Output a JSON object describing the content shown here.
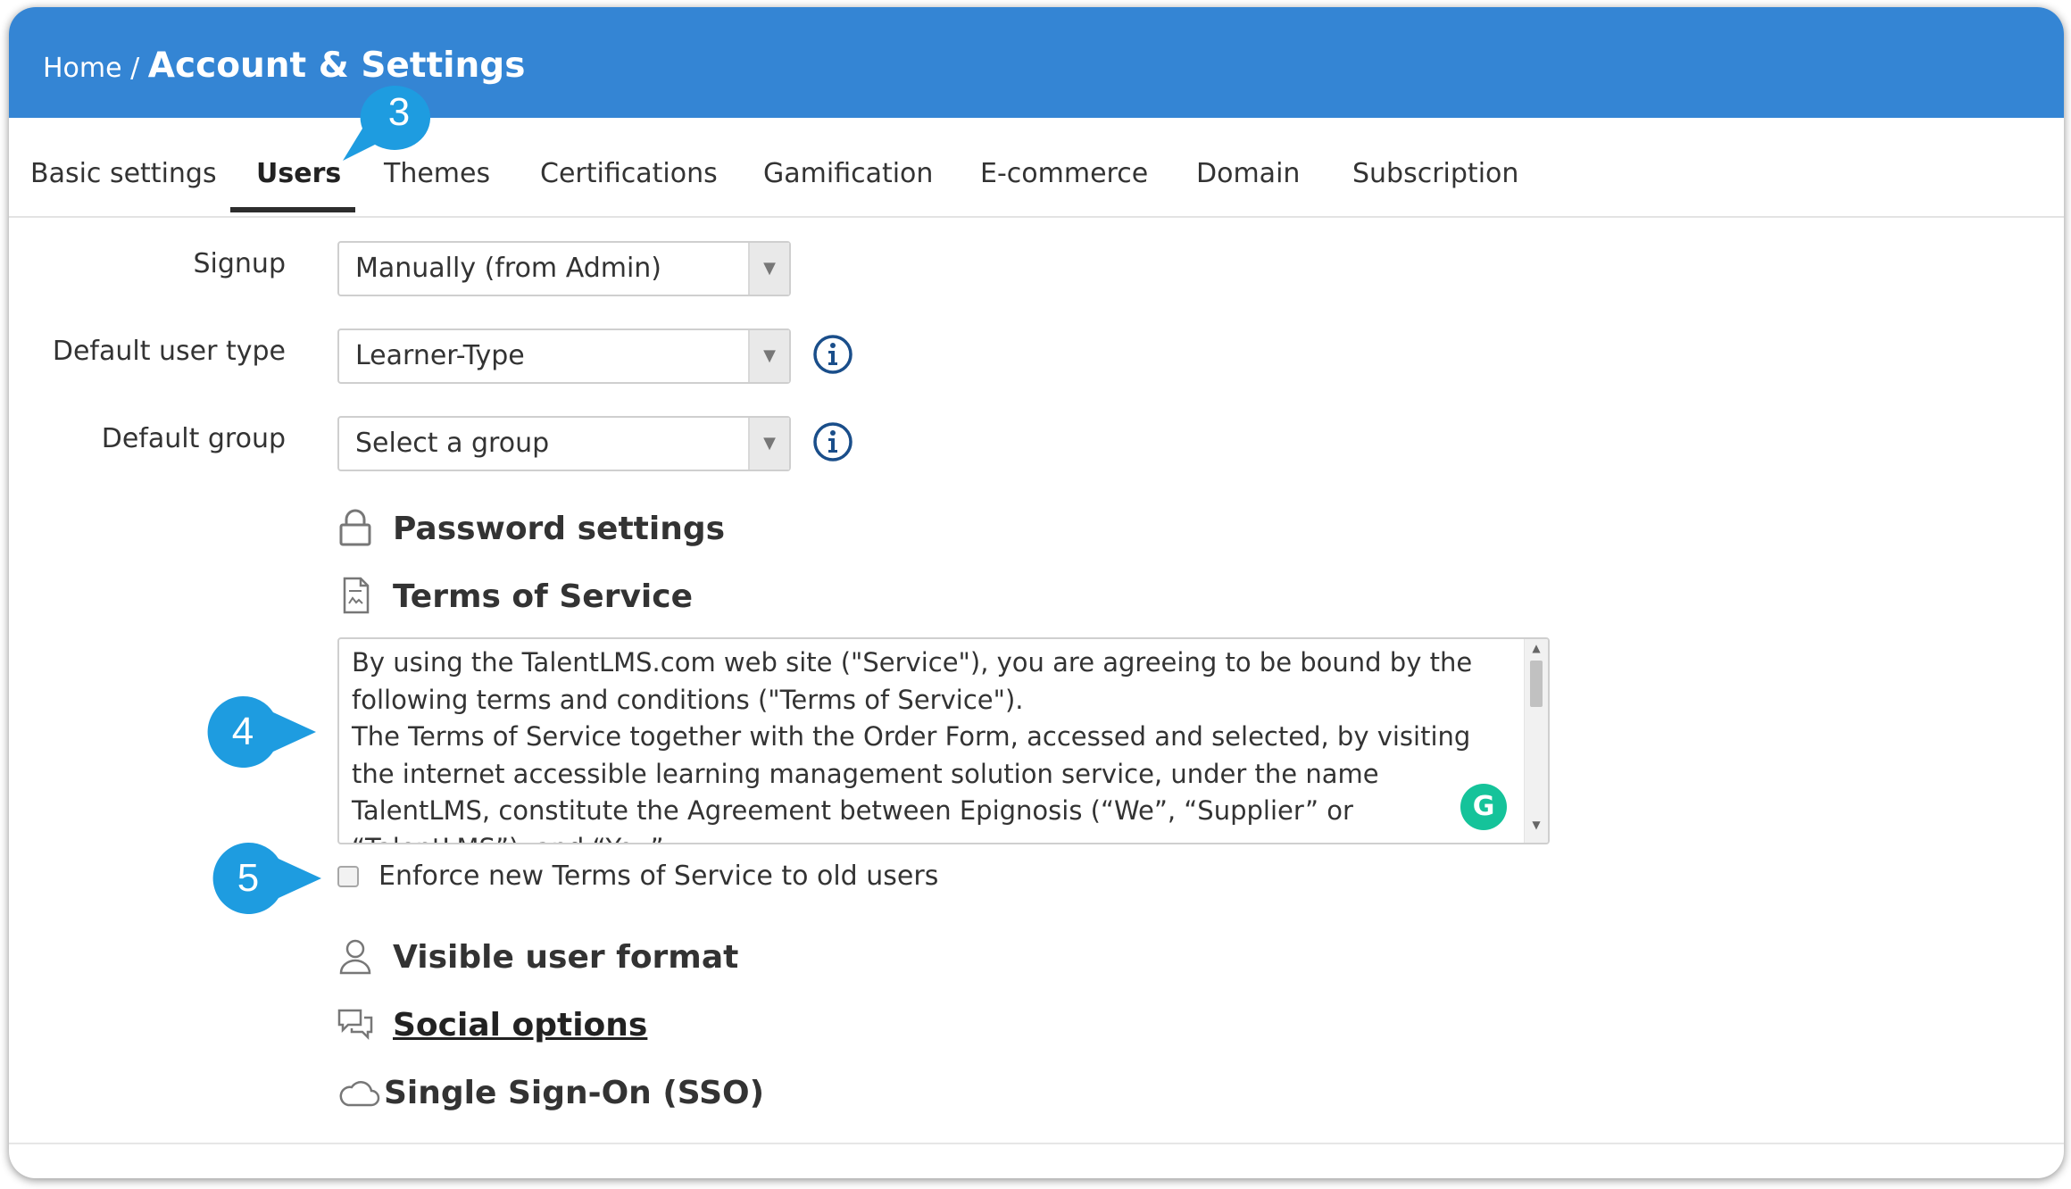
{
  "breadcrumb": {
    "home": "Home",
    "separator": " / ",
    "title": "Account & Settings"
  },
  "tabs": [
    {
      "label": "Basic settings",
      "active": false
    },
    {
      "label": "Users",
      "active": true
    },
    {
      "label": "Themes",
      "active": false
    },
    {
      "label": "Certifications",
      "active": false
    },
    {
      "label": "Gamification",
      "active": false
    },
    {
      "label": "E-commerce",
      "active": false
    },
    {
      "label": "Domain",
      "active": false
    },
    {
      "label": "Subscription",
      "active": false
    }
  ],
  "form": {
    "signup": {
      "label": "Signup",
      "value": "Manually (from Admin)"
    },
    "default_user_type": {
      "label": "Default user type",
      "value": "Learner-Type"
    },
    "default_group": {
      "label": "Default group",
      "value": "Select a group"
    }
  },
  "sections": {
    "password": "Password settings",
    "tos": "Terms of Service",
    "visible_user_format": "Visible user format",
    "social_options": "Social options",
    "sso": "Single Sign-On (SSO)"
  },
  "tos_text": {
    "p1": "By using the TalentLMS.com web site (\"Service\"), you are agreeing to be bound by the following terms and conditions (\"Terms of Service\").",
    "p2": "The Terms of Service together with the Order Form, accessed and selected, by visiting the internet accessible learning management solution service, under the name TalentLMS, constitute the Agreement between Epignosis (“We”, “Supplier” or “TalentLMS”), and “You”"
  },
  "enforce_tos": {
    "label": "Enforce new Terms of Service to old users",
    "checked": false
  },
  "callouts": {
    "c3": "3",
    "c4": "4",
    "c5": "5"
  },
  "colors": {
    "header": "#3485d4",
    "callout": "#1e9ce0",
    "info_icon": "#1a4e8a",
    "grammarly": "#15c39a"
  },
  "icons": [
    "lock-icon",
    "document-icon",
    "user-icon",
    "chat-bubbles-icon",
    "cloud-icon",
    "info-icon",
    "dropdown-arrow-icon",
    "grammarly-icon"
  ]
}
